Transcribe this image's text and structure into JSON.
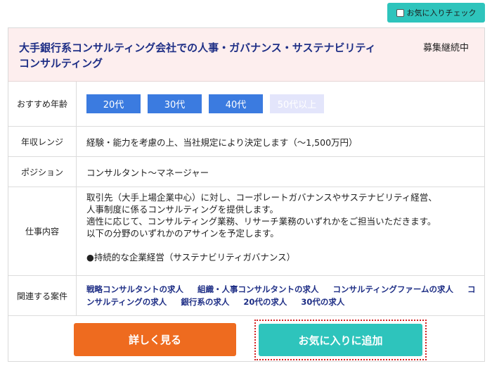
{
  "favorite_check": {
    "label": "お気に入りチェック"
  },
  "job": {
    "title_line1": "大手銀行系コンサルティング会社での人事・ガバナンス・サステナビリティ",
    "title_line2": "コンサルティング",
    "status": "募集継続中"
  },
  "details": {
    "age": {
      "label": "おすすめ年齢",
      "tags": [
        {
          "label": "20代",
          "active": true
        },
        {
          "label": "30代",
          "active": true
        },
        {
          "label": "40代",
          "active": true
        },
        {
          "label": "50代以上",
          "active": false
        }
      ]
    },
    "salary": {
      "label": "年収レンジ",
      "value": "経験・能力を考慮の上、当社規定により決定します（〜1,500万円）"
    },
    "position": {
      "label": "ポジション",
      "value": "コンサルタント〜マネージャー"
    },
    "work": {
      "label": "仕事内容",
      "lines": [
        "取引先（大手上場企業中心）に対し、コーポレートガバナンスやサステナビリティ経営、",
        "人事制度に係るコンサルティングを提供します。",
        "適性に応じて、コンサルティング業務、リサーチ業務のいずれかをご担当いただきます。",
        "以下の分野のいずれかのアサインを予定します。",
        "●持続的な企業経営（サステナビリティガバナンス）"
      ]
    },
    "related": {
      "label": "関連する案件",
      "links": [
        "戦略コンサルタントの求人",
        "組織・人事コンサルタントの求人",
        "コンサルティングファームの求人",
        "コンサルティングの求人",
        "銀行系の求人",
        "20代の求人",
        "30代の求人"
      ]
    }
  },
  "actions": {
    "detail_label": "詳しく見る",
    "favorite_label": "お気に入りに追加"
  },
  "colors": {
    "accent_teal": "#2ec4bc",
    "accent_orange": "#ee6b1f",
    "age_tag_blue": "#3b7be0",
    "title_navy": "#1f2f86"
  }
}
